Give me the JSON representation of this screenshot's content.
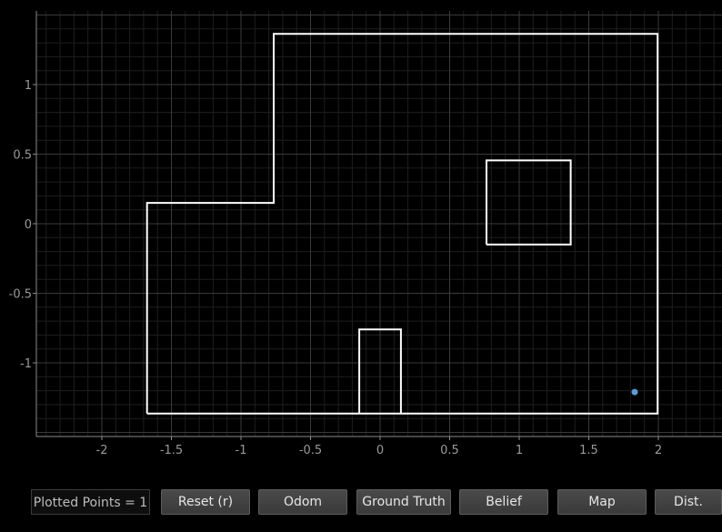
{
  "plot": {
    "x_range": [
      -2.5,
      2.5
    ],
    "y_range": [
      -1.5,
      1.5
    ],
    "x_ticks": [
      -2,
      -1.5,
      -1,
      -0.5,
      0,
      0.5,
      1,
      1.5,
      2,
      2.5
    ],
    "x_tick_labels": [
      "-2",
      "-1.5",
      "-1",
      "-0.5",
      "0",
      "0.5",
      "1",
      "1.5",
      "2",
      "2"
    ],
    "y_ticks": [
      1,
      0.5,
      0,
      -0.5,
      -1
    ],
    "y_tick_labels": [
      "1",
      "0.5",
      "0",
      "-0.5",
      "-1"
    ],
    "grid": true,
    "colors": {
      "background": "#000000",
      "grid_major": "#3a3a3a",
      "grid_minor": "#1e1e1e",
      "axis": "#8a8a8a",
      "tick_label": "#9a9a9a",
      "map_line": "#ffffff",
      "point": "#5b9bd5"
    },
    "map_polylines": [
      {
        "name": "outer-wall",
        "points": [
          [
            -1.675,
            -1.365
          ],
          [
            -1.675,
            0.15
          ],
          [
            -0.765,
            0.15
          ],
          [
            -0.765,
            1.365
          ],
          [
            1.995,
            1.365
          ],
          [
            1.995,
            -1.365
          ],
          [
            -1.675,
            -1.365
          ]
        ]
      },
      {
        "name": "square-obstacle",
        "points": [
          [
            0.765,
            -0.15
          ],
          [
            1.37,
            -0.15
          ],
          [
            1.37,
            0.455
          ],
          [
            0.765,
            0.455
          ],
          [
            0.765,
            -0.15
          ]
        ]
      },
      {
        "name": "bottom-box-obstacle",
        "points": [
          [
            -0.15,
            -1.365
          ],
          [
            -0.15,
            -0.76
          ],
          [
            0.15,
            -0.76
          ],
          [
            0.15,
            -1.365
          ]
        ]
      }
    ],
    "points": [
      {
        "name": "plotted-point",
        "x": 1.83,
        "y": -1.21
      }
    ]
  },
  "toolbar": {
    "counter_label": "Plotted Points = 1",
    "reset_label": "Reset (r)",
    "odom_label": "Odom",
    "ground_truth_label": "Ground Truth",
    "belief_label": "Belief",
    "map_label": "Map",
    "dist_label": "Dist."
  }
}
